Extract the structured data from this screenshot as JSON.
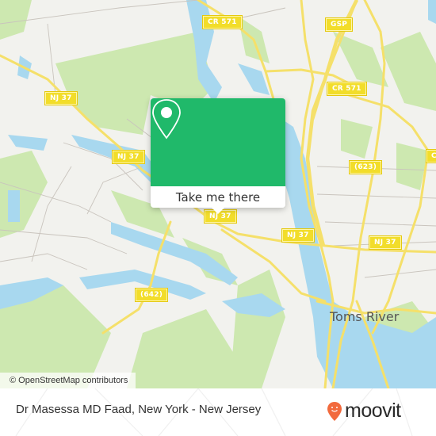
{
  "map": {
    "road_labels": [
      {
        "id": "cr571-top",
        "text": "CR 571"
      },
      {
        "id": "gsp",
        "text": "GSP"
      },
      {
        "id": "cr571-right",
        "text": "CR 571"
      },
      {
        "id": "nj37-a",
        "text": "NJ 37"
      },
      {
        "id": "nj37-b",
        "text": "NJ 37"
      },
      {
        "id": "nj37-c",
        "text": "NJ 37"
      },
      {
        "id": "nj37-d",
        "text": "NJ 37"
      },
      {
        "id": "nj37-e",
        "text": "NJ 37"
      },
      {
        "id": "r623",
        "text": "(623)"
      },
      {
        "id": "r642",
        "text": "(642)"
      },
      {
        "id": "c-edge",
        "text": "C"
      }
    ],
    "place_labels": [
      {
        "text": "Toms River"
      }
    ],
    "attribution": "© OpenStreetMap contributors",
    "colors": {
      "land": "#f2f2ee",
      "forest": "#cde8b0",
      "water": "#a8d8ef",
      "road_major": "#f5e06a",
      "road_minor": "#c9c4bd"
    }
  },
  "popup": {
    "icon": "location-pin-icon",
    "button_label": "Take me there",
    "color": "#20b96a"
  },
  "footer": {
    "title": "Dr Masessa MD Faad, New York - New Jersey",
    "brand": "moovit",
    "brand_color": "#f26a3d"
  }
}
